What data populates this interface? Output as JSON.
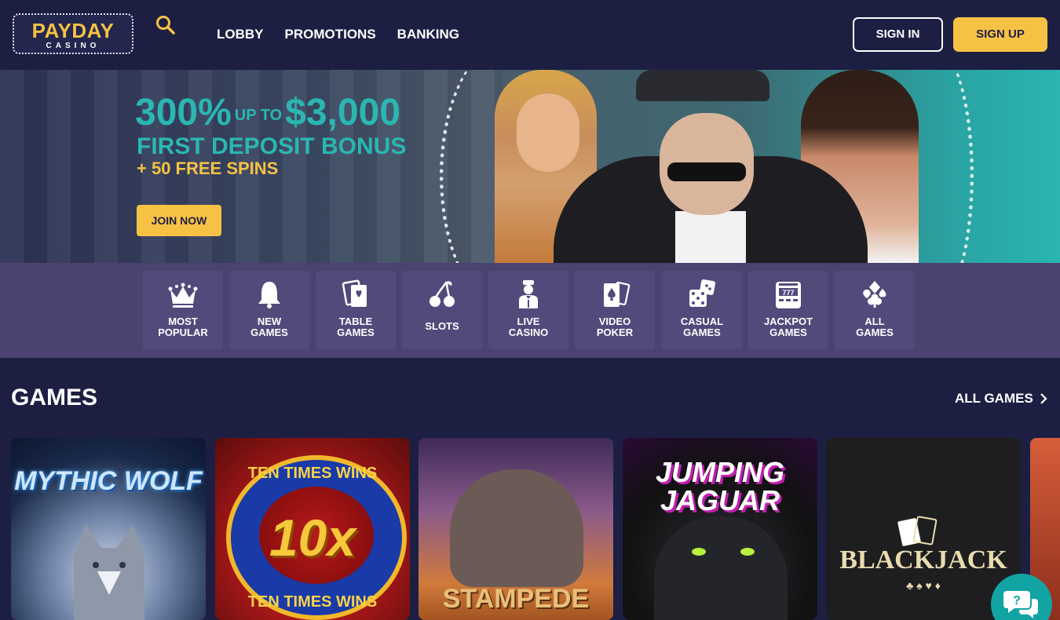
{
  "header": {
    "logo": {
      "top": "PAYDAY",
      "top_a": "PAY",
      "top_b": "DAY",
      "sub": "CASINO"
    },
    "nav": [
      "LOBBY",
      "PROMOTIONS",
      "BANKING"
    ],
    "signin_label": "SIGN IN",
    "signup_label": "SIGN UP"
  },
  "hero": {
    "line1_percent": "300%",
    "line1_upto": "UP TO",
    "line1_amount": "$3,000",
    "line2": "FIRST DEPOSIT BONUS",
    "line3": "+ 50 FREE SPINS",
    "cta_label": "JOIN NOW"
  },
  "categories": [
    {
      "label": "MOST\nPOPULAR",
      "icon": "crown-icon"
    },
    {
      "label": "NEW\nGAMES",
      "icon": "bell-icon"
    },
    {
      "label": "TABLE\nGAMES",
      "icon": "cards-icon"
    },
    {
      "label": "SLOTS",
      "icon": "cherry-icon"
    },
    {
      "label": "LIVE\nCASINO",
      "icon": "dealer-icon"
    },
    {
      "label": "VIDEO\nPOKER",
      "icon": "spade-card-icon"
    },
    {
      "label": "CASUAL\nGAMES",
      "icon": "dice-icon"
    },
    {
      "label": "JACKPOT\nGAMES",
      "icon": "slot-machine-icon"
    },
    {
      "label": "ALL\nGAMES",
      "icon": "suits-icon"
    }
  ],
  "games_section": {
    "title": "GAMES",
    "all_games_label": "ALL GAMES",
    "games": [
      {
        "title": "MYTHIC WOLF"
      },
      {
        "title": "10x",
        "arc_top": "TEN TIMES WINS",
        "arc_bottom": "TEN TIMES WINS"
      },
      {
        "title": "STAMPEDE"
      },
      {
        "title": "JUMPING JAGUAR"
      },
      {
        "title": "BLACKJACK",
        "suits": "♣ ♠ ♥ ♦"
      }
    ]
  },
  "colors": {
    "background": "#1d1f42",
    "accent_yellow": "#f7c244",
    "accent_teal": "#2ab7b2",
    "category_bar": "#4b4272",
    "category_tile": "#524a7b"
  },
  "chat": {
    "icon": "chat-icon"
  }
}
